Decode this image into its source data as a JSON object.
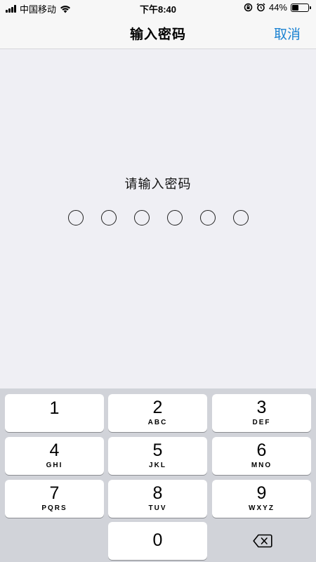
{
  "status_bar": {
    "carrier": "中国移动",
    "time": "下午8:40",
    "battery": "44%",
    "battery_level": 0.44
  },
  "nav": {
    "title": "输入密码",
    "cancel_label": "取消"
  },
  "prompt": "请输入密码",
  "passcode_length": 6,
  "keypad": {
    "k1": {
      "digit": "1",
      "letters": ""
    },
    "k2": {
      "digit": "2",
      "letters": "ABC"
    },
    "k3": {
      "digit": "3",
      "letters": "DEF"
    },
    "k4": {
      "digit": "4",
      "letters": "GHI"
    },
    "k5": {
      "digit": "5",
      "letters": "JKL"
    },
    "k6": {
      "digit": "6",
      "letters": "MNO"
    },
    "k7": {
      "digit": "7",
      "letters": "PQRS"
    },
    "k8": {
      "digit": "8",
      "letters": "TUV"
    },
    "k9": {
      "digit": "9",
      "letters": "WXYZ"
    },
    "k0": {
      "digit": "0",
      "letters": ""
    }
  },
  "colors": {
    "accent": "#1a82d2",
    "background": "#efeff4",
    "keypad_background": "#d1d3d9"
  },
  "icons": [
    "signal-icon",
    "wifi-icon",
    "rotation-lock-icon",
    "alarm-icon",
    "battery-icon",
    "backspace-icon"
  ]
}
